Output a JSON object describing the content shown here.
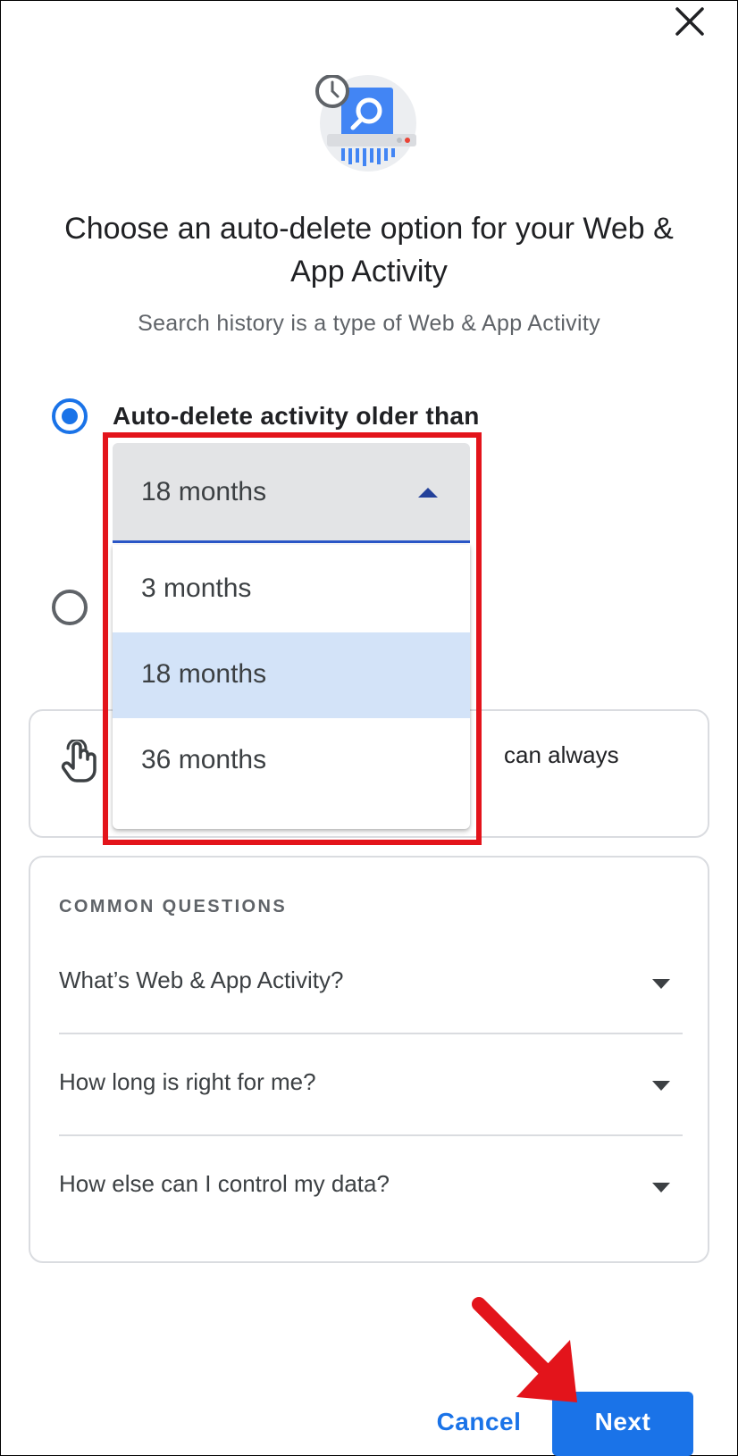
{
  "dialog": {
    "title": "Choose an auto-delete option for your Web & App Activity",
    "subtitle": "Search history is a type of Web & App Activity"
  },
  "options": {
    "auto_delete_label": "Auto-delete activity older than",
    "auto_delete_selected": true
  },
  "dropdown": {
    "current_value": "18 months",
    "expanded": true,
    "items": [
      {
        "label": "3 months",
        "selected": false
      },
      {
        "label": "18 months",
        "selected": true
      },
      {
        "label": "36 months",
        "selected": false
      }
    ]
  },
  "hint": {
    "text_visible": "can always"
  },
  "faq": {
    "heading": "COMMON QUESTIONS",
    "items": [
      {
        "question": "What’s Web & App Activity?"
      },
      {
        "question": "How long is right for me?"
      },
      {
        "question": "How else can I control my data?"
      }
    ]
  },
  "footer": {
    "cancel_label": "Cancel",
    "next_label": "Next"
  },
  "colors": {
    "accent": "#1a73e8",
    "annotation": "#e3141b",
    "menu_selected": "#d3e3f8"
  },
  "icons": {
    "close": "close-icon",
    "hero": "auto-delete-shredder-icon",
    "hint": "hand-touch-icon"
  }
}
